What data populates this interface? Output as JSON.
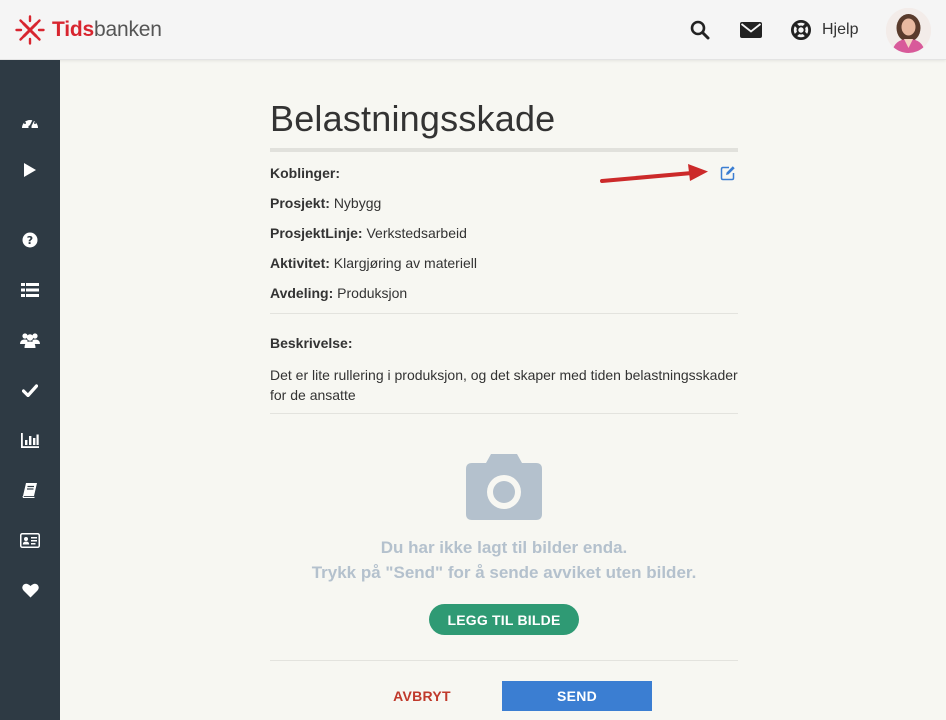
{
  "header": {
    "logo": {
      "part1": "Tids",
      "part2": "banken",
      "icon": "tidsbanken-logo-icon"
    },
    "icons": [
      "search-icon",
      "envelope-icon",
      "lifebuoy-icon"
    ],
    "help_label": "Hjelp",
    "avatar": "user-avatar"
  },
  "sidebar": {
    "items": [
      {
        "icon": "dashboard-icon"
      },
      {
        "icon": "play-icon"
      },
      {
        "icon": "question-icon"
      },
      {
        "icon": "list-icon"
      },
      {
        "icon": "users-icon"
      },
      {
        "icon": "check-icon"
      },
      {
        "icon": "bar-chart-icon"
      },
      {
        "icon": "book-icon"
      },
      {
        "icon": "id-card-icon"
      },
      {
        "icon": "heart-icon"
      }
    ]
  },
  "main": {
    "title": "Belastningsskade",
    "links_label": "Koblinger:",
    "fields": [
      {
        "label": "Prosjekt:",
        "value": "Nybygg"
      },
      {
        "label": "ProsjektLinje:",
        "value": "Verkstedsarbeid"
      },
      {
        "label": "Aktivitet:",
        "value": "Klargjøring av materiell"
      },
      {
        "label": "Avdeling:",
        "value": "Produksjon"
      }
    ],
    "description_label": "Beskrivelse:",
    "description_text": "Det er lite rullering i produksjon, og det skaper med tiden belastningsskader for de ansatte",
    "empty_line1": "Du har ikke lagt til bilder enda.",
    "empty_line2": "Trykk på \"Send\" for å sende avviket uten bilder.",
    "add_image_label": "LEGG TIL BILDE",
    "cancel_label": "AVBRYT",
    "send_label": "SEND"
  },
  "colors": {
    "brand_red": "#d8252f",
    "sidebar_bg": "#2e3a44",
    "add_button": "#2f9a74",
    "send_button": "#3b7ed2",
    "cancel_text": "#c0392b",
    "edit_icon": "#3b7ed2",
    "annotation_arrow": "#cc2a2a"
  }
}
